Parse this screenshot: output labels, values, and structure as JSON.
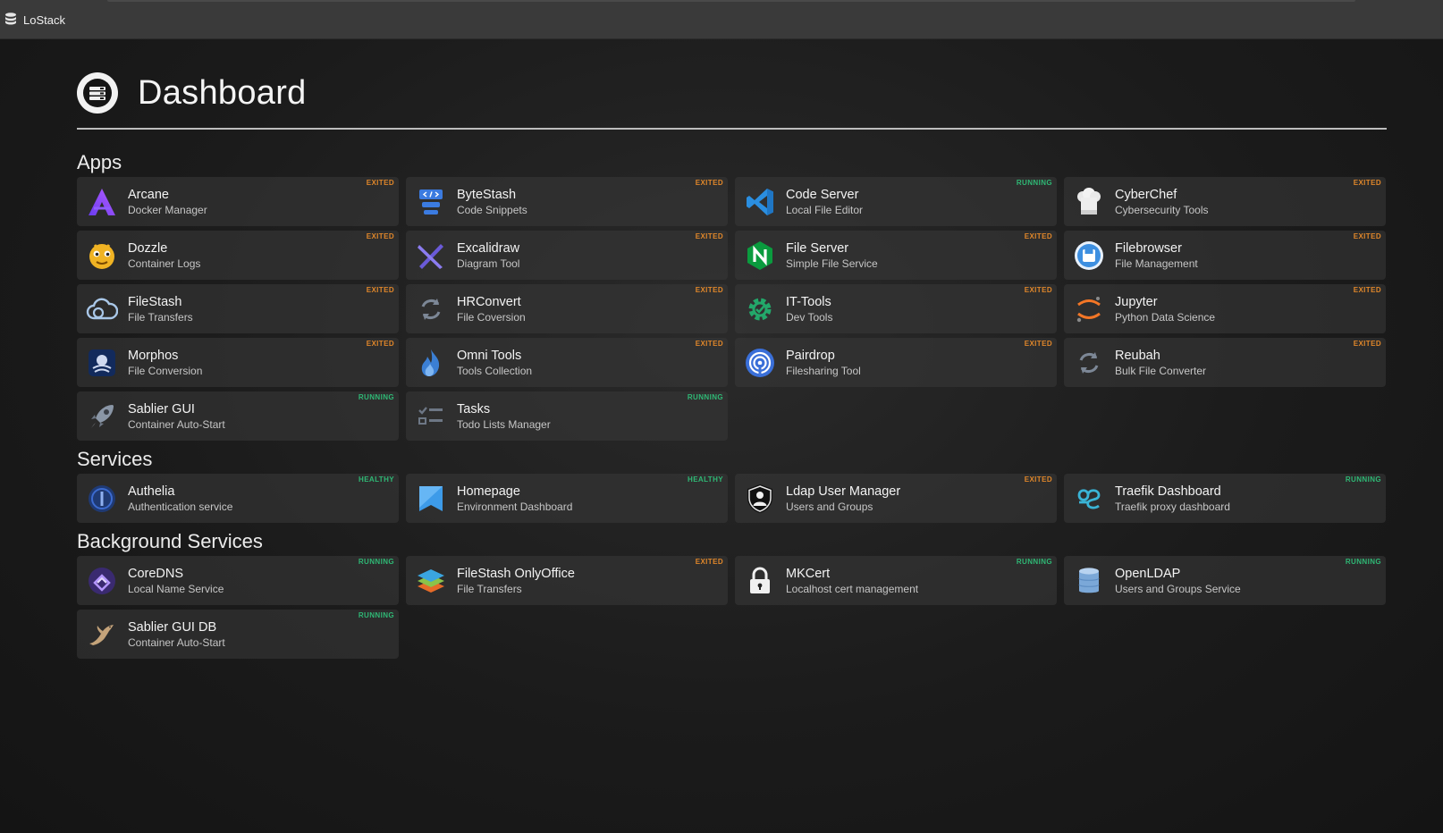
{
  "app": {
    "title": "LoStack"
  },
  "page": {
    "title": "Dashboard"
  },
  "colors": {
    "exited": "#e0872a",
    "running": "#2fb875",
    "healthy": "#2fb875"
  },
  "sections": [
    {
      "title": "Apps",
      "items": [
        {
          "name": "Arcane",
          "desc": "Docker Manager",
          "status": "EXITED",
          "icon": "arcane-icon"
        },
        {
          "name": "ByteStash",
          "desc": "Code Snippets",
          "status": "EXITED",
          "icon": "bytestash-icon"
        },
        {
          "name": "Code Server",
          "desc": "Local File Editor",
          "status": "RUNNING",
          "icon": "vscode-icon"
        },
        {
          "name": "CyberChef",
          "desc": "Cybersecurity Tools",
          "status": "EXITED",
          "icon": "chef-hat-icon"
        },
        {
          "name": "Dozzle",
          "desc": "Container Logs",
          "status": "EXITED",
          "icon": "dozzle-icon"
        },
        {
          "name": "Excalidraw",
          "desc": "Diagram Tool",
          "status": "EXITED",
          "icon": "excalidraw-icon"
        },
        {
          "name": "File Server",
          "desc": "Simple File Service",
          "status": "EXITED",
          "icon": "nginx-icon"
        },
        {
          "name": "Filebrowser",
          "desc": "File Management",
          "status": "EXITED",
          "icon": "filebrowser-icon"
        },
        {
          "name": "FileStash",
          "desc": "File Transfers",
          "status": "EXITED",
          "icon": "cloud-icon"
        },
        {
          "name": "HRConvert",
          "desc": "File Coversion",
          "status": "EXITED",
          "icon": "convert-icon"
        },
        {
          "name": "IT-Tools",
          "desc": "Dev Tools",
          "status": "EXITED",
          "icon": "gear-icon"
        },
        {
          "name": "Jupyter",
          "desc": "Python Data Science",
          "status": "EXITED",
          "icon": "jupyter-icon"
        },
        {
          "name": "Morphos",
          "desc": "File Conversion",
          "status": "EXITED",
          "icon": "morphos-icon"
        },
        {
          "name": "Omni Tools",
          "desc": "Tools Collection",
          "status": "EXITED",
          "icon": "flame-icon"
        },
        {
          "name": "Pairdrop",
          "desc": "Filesharing Tool",
          "status": "EXITED",
          "icon": "pairdrop-icon"
        },
        {
          "name": "Reubah",
          "desc": "Bulk File Converter",
          "status": "EXITED",
          "icon": "convert-icon"
        },
        {
          "name": "Sablier GUI",
          "desc": "Container Auto-Start",
          "status": "RUNNING",
          "icon": "rocket-icon"
        },
        {
          "name": "Tasks",
          "desc": "Todo Lists Manager",
          "status": "RUNNING",
          "icon": "tasks-icon"
        }
      ]
    },
    {
      "title": "Services",
      "items": [
        {
          "name": "Authelia",
          "desc": "Authentication service",
          "status": "HEALTHY",
          "icon": "authelia-icon"
        },
        {
          "name": "Homepage",
          "desc": "Environment Dashboard",
          "status": "HEALTHY",
          "icon": "homepage-icon"
        },
        {
          "name": "Ldap User Manager",
          "desc": "Users and Groups",
          "status": "EXITED",
          "icon": "user-shield-icon"
        },
        {
          "name": "Traefik Dashboard",
          "desc": "Traefik proxy dashboard",
          "status": "RUNNING",
          "icon": "traefik-icon"
        }
      ]
    },
    {
      "title": "Background Services",
      "items": [
        {
          "name": "CoreDNS",
          "desc": "Local Name Service",
          "status": "RUNNING",
          "icon": "coredns-icon"
        },
        {
          "name": "FileStash OnlyOffice",
          "desc": "File Transfers",
          "status": "EXITED",
          "icon": "layers-icon"
        },
        {
          "name": "MKCert",
          "desc": "Localhost cert management",
          "status": "RUNNING",
          "icon": "lock-icon"
        },
        {
          "name": "OpenLDAP",
          "desc": "Users and Groups Service",
          "status": "RUNNING",
          "icon": "database-icon"
        },
        {
          "name": "Sablier GUI DB",
          "desc": "Container Auto-Start",
          "status": "RUNNING",
          "icon": "mariadb-icon"
        }
      ]
    }
  ]
}
